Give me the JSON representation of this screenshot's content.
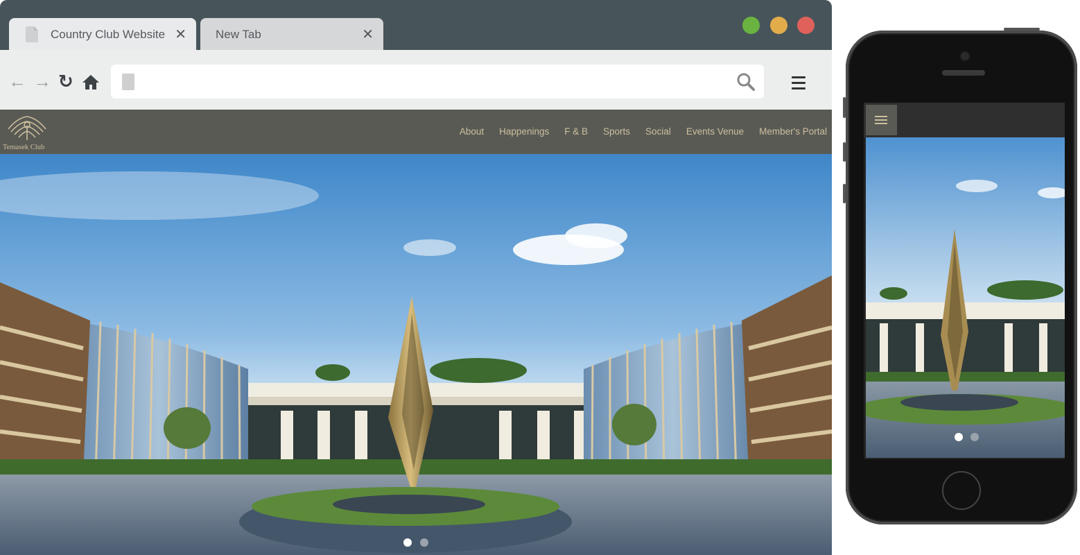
{
  "browser": {
    "tabs": [
      {
        "label": "Country Club Website",
        "active": true
      },
      {
        "label": "New Tab",
        "active": false
      }
    ],
    "tab_close_glyph": "✕",
    "window_controls": {
      "green": "#6ab341",
      "yellow": "#e2ac4b",
      "red": "#e0615b"
    },
    "toolbar": {
      "back_glyph": "←",
      "forward_glyph": "→",
      "reload_glyph": "↻",
      "address_value": "",
      "icons": [
        "back-arrow-icon",
        "forward-arrow-icon",
        "reload-icon",
        "home-icon",
        "page-icon",
        "search-icon",
        "hamburger-menu-icon"
      ]
    }
  },
  "site": {
    "logo_text": "Temasek Club",
    "nav": [
      "About",
      "Happenings",
      "F & B",
      "Sports",
      "Social",
      "Events Venue",
      "Member's Portal"
    ],
    "colors": {
      "nav_bg": "#5a5a55",
      "nav_text": "#cbbf9d"
    },
    "carousel": {
      "slides": 2,
      "active": 1
    }
  },
  "phone": {
    "mobile_nav_icon": "hamburger-menu-icon",
    "carousel": {
      "slides": 2,
      "active": 1
    }
  }
}
